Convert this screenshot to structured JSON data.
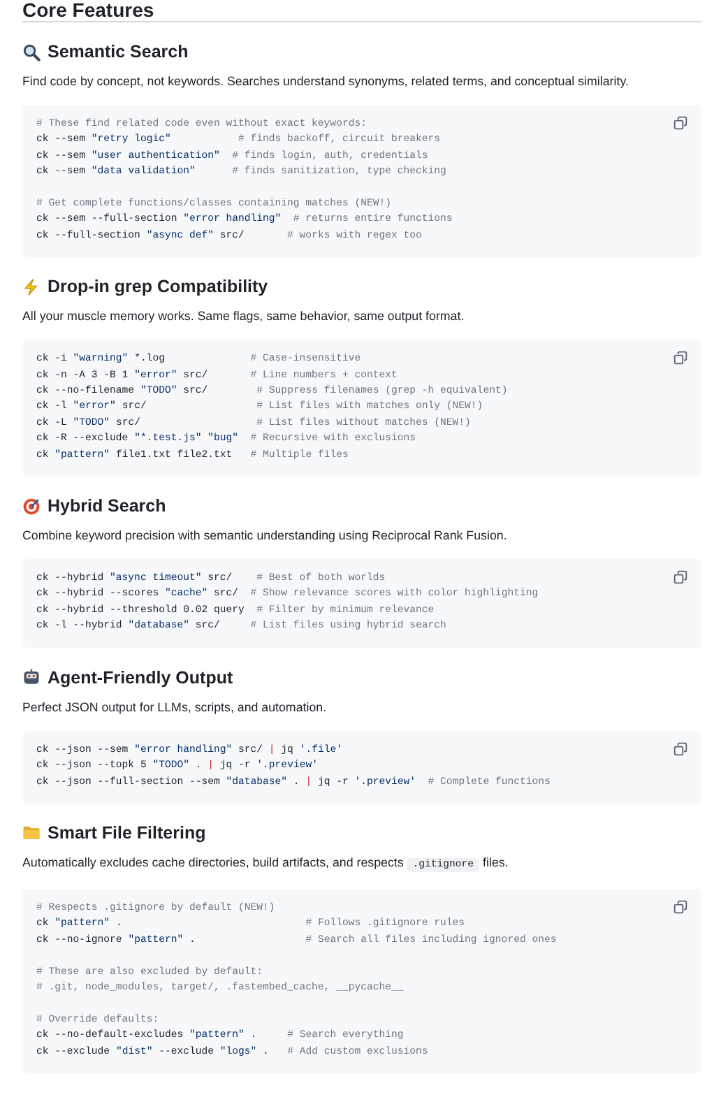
{
  "title": "Core Features",
  "sections": [
    {
      "heading": "Semantic Search",
      "description": [
        {
          "kind": "text",
          "text": "Find code by concept, not keywords. Searches understand synonyms, related terms, and conceptual similarity."
        }
      ],
      "code_groups": [
        [
          "# These find related code even without exact keywords:",
          "ck --sem \"retry logic\"           # finds backoff, circuit breakers",
          "ck --sem \"user authentication\"  # finds login, auth, credentials",
          "ck --sem \"data validation\"      # finds sanitization, type checking"
        ],
        [
          "# Get complete functions/classes containing matches (NEW!)",
          "ck --sem --full-section \"error handling\"  # returns entire functions",
          "ck --full-section \"async def\" src/       # works with regex too"
        ]
      ]
    },
    {
      "heading": "Drop-in grep Compatibility",
      "description": [
        {
          "kind": "text",
          "text": "All your muscle memory works. Same flags, same behavior, same output format."
        }
      ],
      "code_groups": [
        [
          "ck -i \"warning\" *.log              # Case-insensitive",
          "ck -n -A 3 -B 1 \"error\" src/       # Line numbers + context",
          "ck --no-filename \"TODO\" src/        # Suppress filenames (grep -h equivalent)",
          "ck -l \"error\" src/                  # List files with matches only (NEW!)",
          "ck -L \"TODO\" src/                   # List files without matches (NEW!)",
          "ck -R --exclude \"*.test.js\" \"bug\"  # Recursive with exclusions",
          "ck \"pattern\" file1.txt file2.txt   # Multiple files"
        ]
      ]
    },
    {
      "heading": "Hybrid Search",
      "description": [
        {
          "kind": "text",
          "text": "Combine keyword precision with semantic understanding using Reciprocal Rank Fusion."
        }
      ],
      "code_groups": [
        [
          "ck --hybrid \"async timeout\" src/    # Best of both worlds",
          "ck --hybrid --scores \"cache\" src/  # Show relevance scores with color highlighting",
          "ck --hybrid --threshold 0.02 query  # Filter by minimum relevance",
          "ck -l --hybrid \"database\" src/     # List files using hybrid search"
        ]
      ]
    },
    {
      "heading": "Agent-Friendly Output",
      "description": [
        {
          "kind": "text",
          "text": "Perfect JSON output for LLMs, scripts, and automation."
        }
      ],
      "code_groups": [
        [
          "ck --json --sem \"error handling\" src/ | jq '.file'",
          "ck --json --topk 5 \"TODO\" . | jq -r '.preview'",
          "ck --json --full-section --sem \"database\" . | jq -r '.preview'  # Complete functions"
        ]
      ]
    },
    {
      "heading": "Smart File Filtering",
      "description": [
        {
          "kind": "text",
          "text": "Automatically excludes cache directories, build artifacts, and respects "
        },
        {
          "kind": "code",
          "text": ".gitignore"
        },
        {
          "kind": "text",
          "text": " files."
        }
      ],
      "code_groups": [
        [
          "# Respects .gitignore by default (NEW!)",
          "ck \"pattern\" .                              # Follows .gitignore rules",
          "ck --no-ignore \"pattern\" .                  # Search all files including ignored ones"
        ],
        [
          "# These are also excluded by default:",
          "# .git, node_modules, target/, .fastembed_cache, __pycache__"
        ],
        [
          "# Override defaults:",
          "ck --no-default-excludes \"pattern\" .     # Search everything",
          "ck --exclude \"dist\" --exclude \"logs\" .   # Add custom exclusions"
        ]
      ]
    }
  ]
}
